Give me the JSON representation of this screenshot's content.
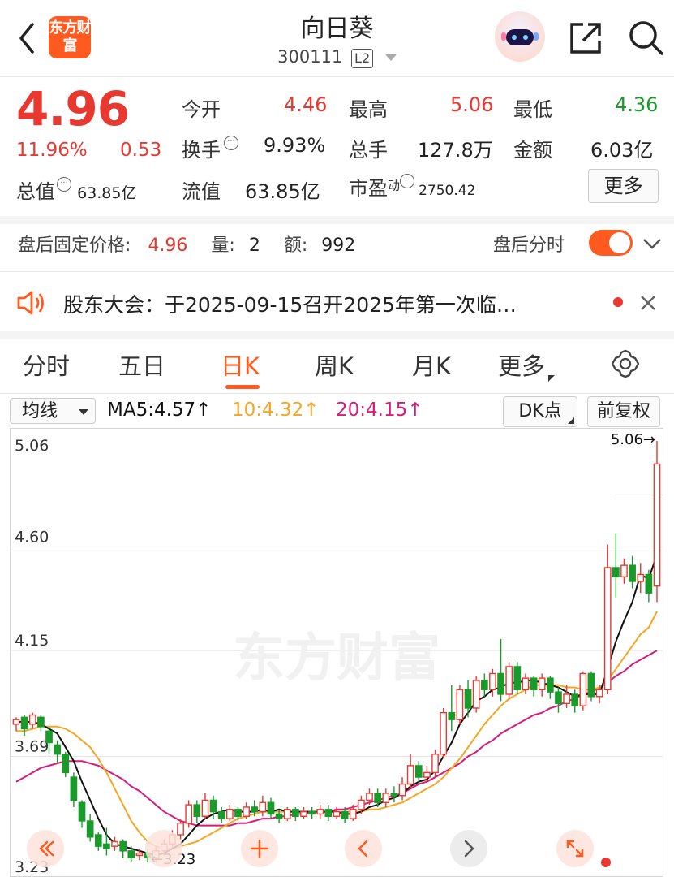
{
  "header": {
    "logo_text": "东方财富",
    "title": "向日葵",
    "code": "300111",
    "level_badge": "L2",
    "icons": [
      "back-chevron-icon",
      "robot-avatar-icon",
      "share-icon",
      "search-icon"
    ]
  },
  "quote": {
    "price": "4.96",
    "change_pct": "11.96%",
    "change": "0.53",
    "open_label": "今开",
    "open": "4.46",
    "high_label": "最高",
    "high": "5.06",
    "low_label": "最低",
    "low": "4.36",
    "turnover_label": "换手",
    "turnover": "9.93%",
    "volume_label": "总手",
    "volume": "127.8万",
    "amount_label": "金额",
    "amount": "6.03亿",
    "mktcap_label": "总值",
    "mktcap": "63.85亿",
    "float_label": "流值",
    "float_cap": "63.85亿",
    "pe_label": "市盈",
    "pe_sup": "动",
    "pe": "2750.42",
    "more_label": "更多"
  },
  "after_hours": {
    "price_label": "盘后固定价格:",
    "price": "4.96",
    "qty_label": "量:",
    "qty": "2",
    "amt_label": "额:",
    "amt": "992",
    "toggle_label": "盘后分时",
    "toggle_on": true
  },
  "notice": {
    "text": "股东大会：于2025-09-15召开2025年第一次临…"
  },
  "tabs": [
    "分时",
    "五日",
    "日K",
    "周K",
    "月K",
    "更多"
  ],
  "active_tab": "日K",
  "chart_toolbar": {
    "indicator": "均线",
    "ma5": "MA5:4.57",
    "ma10": "10:4.32",
    "ma20": "20:4.15",
    "arrow": "↑",
    "dk_label": "DK点",
    "adjust_label": "前复权"
  },
  "colors": {
    "up": "#e8382f",
    "down": "#1a9a2a",
    "ma5": "#111111",
    "ma10": "#f5a623",
    "ma20": "#d81b7a",
    "accent": "#ff5a1f"
  },
  "chart_data": {
    "type": "candlestick",
    "y_ticks": [
      "5.06",
      "4.60",
      "4.15",
      "3.69",
      "3.23"
    ],
    "ylim": [
      3.23,
      5.06
    ],
    "max_marker": "5.06→",
    "min_marker": "←3.23",
    "watermark": "东方财富",
    "candles": [
      [
        3.83,
        3.85,
        3.8,
        3.86
      ],
      [
        3.86,
        3.81,
        3.78,
        3.87
      ],
      [
        3.83,
        3.87,
        3.81,
        3.88
      ],
      [
        3.86,
        3.82,
        3.8,
        3.87
      ],
      [
        3.8,
        3.75,
        3.7,
        3.82
      ],
      [
        3.74,
        3.7,
        3.66,
        3.76
      ],
      [
        3.7,
        3.62,
        3.6,
        3.71
      ],
      [
        3.6,
        3.5,
        3.47,
        3.62
      ],
      [
        3.49,
        3.41,
        3.38,
        3.5
      ],
      [
        3.41,
        3.34,
        3.32,
        3.44
      ],
      [
        3.35,
        3.3,
        3.28,
        3.36
      ],
      [
        3.31,
        3.29,
        3.26,
        3.38
      ],
      [
        3.3,
        3.32,
        3.28,
        3.34
      ],
      [
        3.32,
        3.28,
        3.25,
        3.33
      ],
      [
        3.28,
        3.25,
        3.23,
        3.3
      ],
      [
        3.26,
        3.27,
        3.24,
        3.29
      ],
      [
        3.27,
        3.25,
        3.23,
        3.29
      ],
      [
        3.25,
        3.28,
        3.23,
        3.3
      ],
      [
        3.28,
        3.31,
        3.26,
        3.33
      ],
      [
        3.31,
        3.35,
        3.29,
        3.37
      ],
      [
        3.35,
        3.4,
        3.33,
        3.42
      ],
      [
        3.4,
        3.48,
        3.38,
        3.5
      ],
      [
        3.48,
        3.43,
        3.4,
        3.5
      ],
      [
        3.43,
        3.5,
        3.42,
        3.53
      ],
      [
        3.5,
        3.45,
        3.42,
        3.52
      ],
      [
        3.45,
        3.42,
        3.4,
        3.47
      ],
      [
        3.42,
        3.46,
        3.41,
        3.48
      ],
      [
        3.46,
        3.43,
        3.41,
        3.47
      ],
      [
        3.43,
        3.47,
        3.42,
        3.49
      ],
      [
        3.47,
        3.45,
        3.43,
        3.5
      ],
      [
        3.45,
        3.49,
        3.43,
        3.52
      ],
      [
        3.49,
        3.44,
        3.42,
        3.51
      ],
      [
        3.44,
        3.42,
        3.4,
        3.46
      ],
      [
        3.42,
        3.46,
        3.41,
        3.47
      ],
      [
        3.46,
        3.43,
        3.41,
        3.47
      ],
      [
        3.43,
        3.45,
        3.42,
        3.47
      ],
      [
        3.45,
        3.44,
        3.42,
        3.47
      ],
      [
        3.44,
        3.46,
        3.42,
        3.48
      ],
      [
        3.46,
        3.43,
        3.41,
        3.48
      ],
      [
        3.43,
        3.45,
        3.42,
        3.47
      ],
      [
        3.45,
        3.42,
        3.4,
        3.47
      ],
      [
        3.42,
        3.46,
        3.41,
        3.48
      ],
      [
        3.46,
        3.5,
        3.44,
        3.52
      ],
      [
        3.5,
        3.53,
        3.48,
        3.55
      ],
      [
        3.53,
        3.49,
        3.47,
        3.55
      ],
      [
        3.49,
        3.53,
        3.47,
        3.55
      ],
      [
        3.53,
        3.52,
        3.49,
        3.56
      ],
      [
        3.52,
        3.57,
        3.5,
        3.6
      ],
      [
        3.57,
        3.65,
        3.55,
        3.7
      ],
      [
        3.65,
        3.6,
        3.57,
        3.67
      ],
      [
        3.6,
        3.62,
        3.58,
        3.65
      ],
      [
        3.62,
        3.7,
        3.6,
        3.72
      ],
      [
        3.7,
        3.88,
        3.68,
        3.9
      ],
      [
        3.88,
        3.85,
        3.8,
        4.0
      ],
      [
        3.85,
        3.98,
        3.83,
        4.0
      ],
      [
        3.98,
        3.9,
        3.86,
        4.02
      ],
      [
        3.9,
        4.02,
        3.88,
        4.04
      ],
      [
        4.02,
        3.98,
        3.95,
        4.05
      ],
      [
        3.98,
        4.05,
        3.95,
        4.07
      ],
      [
        4.05,
        3.96,
        3.93,
        4.2
      ],
      [
        3.96,
        4.08,
        3.94,
        4.1
      ],
      [
        4.08,
        3.98,
        3.96,
        4.1
      ],
      [
        3.98,
        4.03,
        3.96,
        4.05
      ],
      [
        4.03,
        3.98,
        3.95,
        4.04
      ],
      [
        3.98,
        4.03,
        3.95,
        4.05
      ],
      [
        4.03,
        3.97,
        3.94,
        4.04
      ],
      [
        3.97,
        3.92,
        3.88,
        3.99
      ],
      [
        3.92,
        3.96,
        3.9,
        4.0
      ],
      [
        3.96,
        3.91,
        3.88,
        3.98
      ],
      [
        3.91,
        4.05,
        3.89,
        4.06
      ],
      [
        4.05,
        3.95,
        3.93,
        4.06
      ],
      [
        3.95,
        3.98,
        3.92,
        4.0
      ],
      [
        3.98,
        4.51,
        3.96,
        4.61
      ],
      [
        4.51,
        4.47,
        4.38,
        4.66
      ],
      [
        4.47,
        4.52,
        4.44,
        4.55
      ],
      [
        4.52,
        4.45,
        4.42,
        4.56
      ],
      [
        4.45,
        4.48,
        4.4,
        4.53
      ],
      [
        4.48,
        4.4,
        4.36,
        4.5
      ],
      [
        4.43,
        4.96,
        4.36,
        5.06
      ]
    ],
    "ma5": [
      3.84,
      3.84,
      3.84,
      3.83,
      3.81,
      3.79,
      3.73,
      3.67,
      3.58,
      3.5,
      3.42,
      3.35,
      3.31,
      3.3,
      3.29,
      3.28,
      3.27,
      3.26,
      3.27,
      3.29,
      3.31,
      3.35,
      3.39,
      3.42,
      3.44,
      3.45,
      3.46,
      3.45,
      3.45,
      3.45,
      3.46,
      3.45,
      3.46,
      3.45,
      3.45,
      3.45,
      3.45,
      3.45,
      3.45,
      3.45,
      3.44,
      3.44,
      3.45,
      3.47,
      3.48,
      3.5,
      3.51,
      3.53,
      3.56,
      3.58,
      3.59,
      3.63,
      3.69,
      3.75,
      3.83,
      3.88,
      3.93,
      3.95,
      3.98,
      3.99,
      4.01,
      4.01,
      4.02,
      4.02,
      4.01,
      4.0,
      3.99,
      3.97,
      3.95,
      3.96,
      3.96,
      3.96,
      4.07,
      4.19,
      4.28,
      4.36,
      4.48,
      4.46,
      4.57
    ],
    "ma10": [
      3.8,
      3.8,
      3.81,
      3.82,
      3.82,
      3.82,
      3.81,
      3.79,
      3.76,
      3.73,
      3.68,
      3.62,
      3.55,
      3.48,
      3.41,
      3.36,
      3.32,
      3.3,
      3.29,
      3.29,
      3.3,
      3.31,
      3.32,
      3.34,
      3.36,
      3.38,
      3.4,
      3.42,
      3.43,
      3.44,
      3.45,
      3.45,
      3.45,
      3.45,
      3.45,
      3.45,
      3.45,
      3.45,
      3.45,
      3.45,
      3.45,
      3.45,
      3.45,
      3.46,
      3.46,
      3.47,
      3.48,
      3.49,
      3.51,
      3.53,
      3.55,
      3.57,
      3.6,
      3.64,
      3.68,
      3.73,
      3.78,
      3.83,
      3.87,
      3.91,
      3.94,
      3.96,
      3.98,
      4.0,
      4.0,
      4.0,
      4.0,
      3.99,
      3.99,
      3.98,
      3.98,
      3.99,
      4.02,
      4.07,
      4.12,
      4.17,
      4.22,
      4.25,
      4.32
    ],
    "ma20": [
      3.58,
      3.6,
      3.62,
      3.64,
      3.65,
      3.66,
      3.67,
      3.67,
      3.67,
      3.66,
      3.65,
      3.63,
      3.61,
      3.59,
      3.56,
      3.54,
      3.51,
      3.48,
      3.45,
      3.43,
      3.41,
      3.4,
      3.39,
      3.39,
      3.39,
      3.39,
      3.39,
      3.4,
      3.4,
      3.41,
      3.42,
      3.42,
      3.43,
      3.43,
      3.44,
      3.44,
      3.45,
      3.45,
      3.45,
      3.46,
      3.46,
      3.47,
      3.48,
      3.49,
      3.5,
      3.51,
      3.52,
      3.53,
      3.55,
      3.57,
      3.58,
      3.6,
      3.62,
      3.64,
      3.66,
      3.69,
      3.71,
      3.74,
      3.76,
      3.79,
      3.81,
      3.83,
      3.85,
      3.87,
      3.88,
      3.9,
      3.91,
      3.93,
      3.94,
      3.96,
      3.97,
      3.99,
      4.01,
      4.04,
      4.06,
      4.09,
      4.11,
      4.13,
      4.15
    ]
  }
}
